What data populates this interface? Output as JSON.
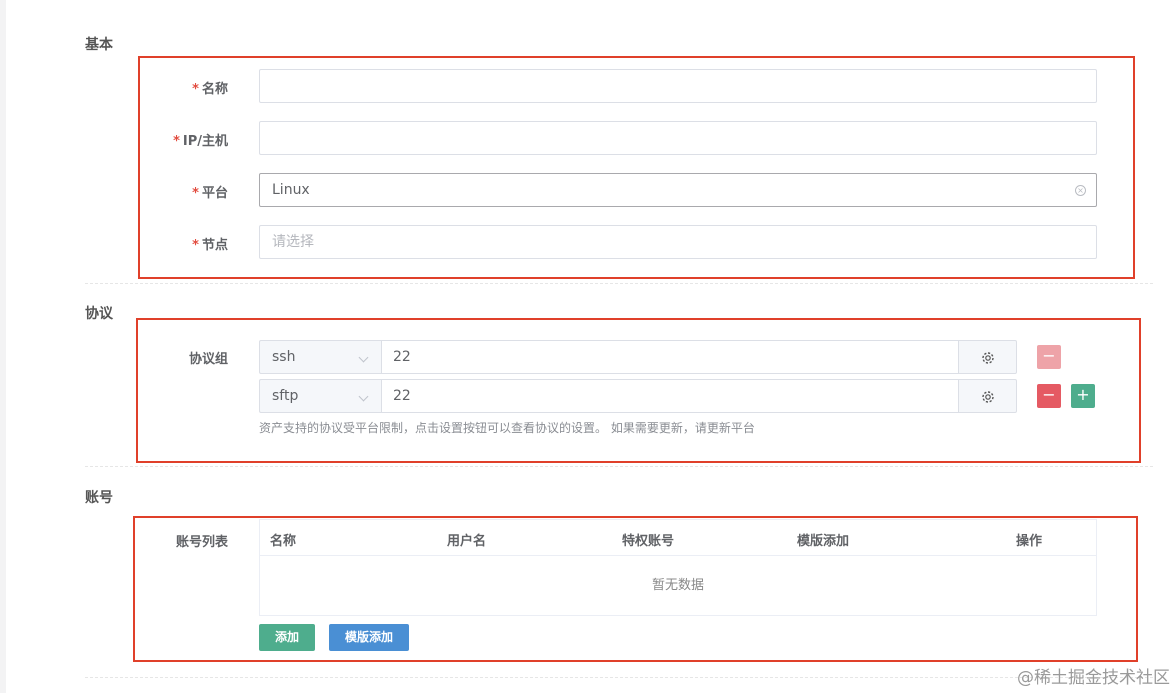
{
  "sections": {
    "basic": "基本",
    "protocol": "协议",
    "account": "账号"
  },
  "basic": {
    "required_mark": "*",
    "name_label": "名称",
    "name_value": "",
    "host_label": "IP/主机",
    "host_value": "",
    "platform_label": "平台",
    "platform_value": "Linux",
    "node_label": "节点",
    "node_placeholder": "请选择"
  },
  "protocol": {
    "group_label": "协议组",
    "rows": [
      {
        "protocol": "ssh",
        "port": "22"
      },
      {
        "protocol": "sftp",
        "port": "22"
      }
    ],
    "hint": "资产支持的协议受平台限制，点击设置按钮可以查看协议的设置。 如果需要更新，请更新平台",
    "minus_symbol": "−",
    "plus_symbol": "+"
  },
  "account": {
    "list_label": "账号列表",
    "columns": [
      "名称",
      "用户名",
      "特权账号",
      "模版添加",
      "操作"
    ],
    "empty_text": "暂无数据",
    "add_button": "添加",
    "template_button": "模版添加"
  },
  "watermark": "@稀土掘金技术社区",
  "colors": {
    "highlight": "#e0402a",
    "required": "#e24c3f",
    "success": "#4ead8d",
    "danger": "#e55a63",
    "primary": "#4a8fd4"
  }
}
